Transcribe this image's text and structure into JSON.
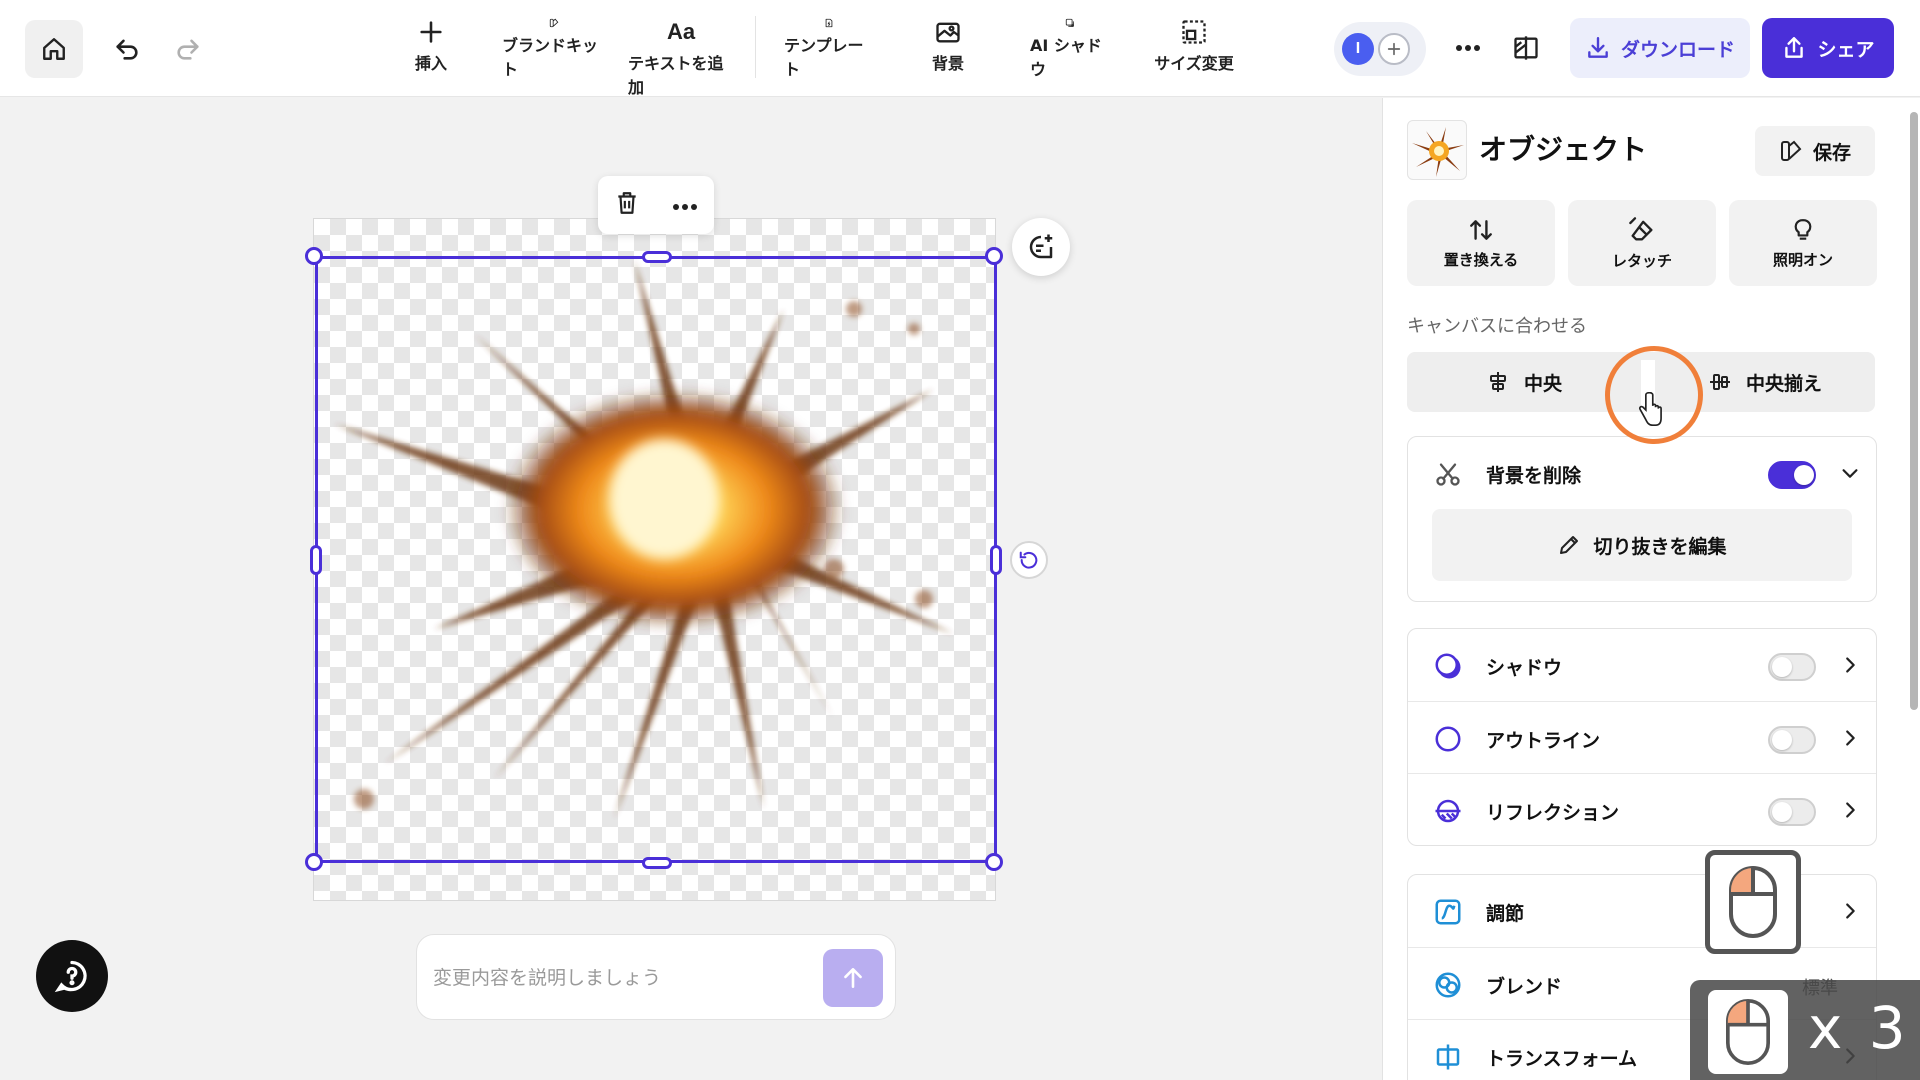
{
  "toolbar": {
    "tools": [
      {
        "label": "挿入",
        "icon": "plus-icon"
      },
      {
        "label": "ブランドキット",
        "icon": "brand-kit-icon"
      },
      {
        "label": "テキストを追加",
        "icon": "text-aa-icon",
        "glyph": "Aa"
      },
      {
        "label": "テンプレート",
        "icon": "template-icon"
      },
      {
        "label": "背景",
        "icon": "background-icon"
      },
      {
        "label": "AI シャドウ",
        "icon": "ai-shadow-icon"
      },
      {
        "label": "サイズ変更",
        "icon": "resize-icon"
      }
    ],
    "avatar_initial": "I",
    "download_label": "ダウンロード",
    "share_label": "シェア"
  },
  "canvas": {
    "prompt_placeholder": "変更内容を説明しましょう"
  },
  "panel": {
    "title": "オブジェクト",
    "save_label": "保存",
    "actions": [
      {
        "label": "置き換える",
        "icon": "replace-icon"
      },
      {
        "label": "レタッチ",
        "icon": "retouch-eraser-icon"
      },
      {
        "label": "照明オン",
        "icon": "lightbulb-icon"
      }
    ],
    "fit_canvas_label": "キャンバスに合わせる",
    "align_center_label": "中央",
    "align_middle_label": "中央揃え",
    "remove_bg_label": "背景を削除",
    "remove_bg_on": true,
    "edit_cutout_label": "切り抜きを編集",
    "effects": [
      {
        "label": "シャドウ",
        "icon": "shadow-icon",
        "on": false
      },
      {
        "label": "アウトライン",
        "icon": "outline-icon",
        "on": false
      },
      {
        "label": "リフレクション",
        "icon": "reflection-icon",
        "on": false
      }
    ],
    "more": [
      {
        "label": "調節",
        "icon": "adjust-icon"
      },
      {
        "label": "ブレンド",
        "icon": "blend-icon",
        "value": "標準"
      },
      {
        "label": "トランスフォーム",
        "icon": "transform-icon"
      }
    ]
  },
  "overlay": {
    "click_count": "x 3"
  },
  "colors": {
    "accent": "#4a2fd8",
    "cursor_ring": "#f07f3a"
  }
}
